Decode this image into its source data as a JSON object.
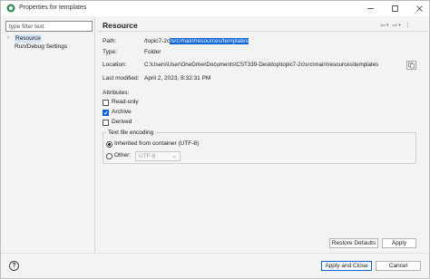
{
  "window": {
    "title": "Properties for templates"
  },
  "filter": {
    "placeholder": "type filter text"
  },
  "tree": {
    "items": [
      {
        "label": "Resource",
        "selected": true,
        "expandable": true
      },
      {
        "label": "Run/Debug Settings",
        "selected": false,
        "expandable": false
      }
    ]
  },
  "page": {
    "title": "Resource"
  },
  "info": {
    "path_label": "Path:",
    "path_prefix": "/topic7-2c",
    "path_selected": "/src/main/resources/templates",
    "type_label": "Type:",
    "type_value": "Folder",
    "location_label": "Location:",
    "location_value": "C:\\Users\\User\\OneDrive\\Documents\\CST339-Desktop\\topic7-2c\\src\\main\\resources\\templates",
    "modified_label": "Last modified:",
    "modified_value": "April 2, 2023, 8:32:31 PM"
  },
  "attributes": {
    "heading": "Attributes:",
    "items": [
      {
        "label": "Read-only",
        "checked": false
      },
      {
        "label": "Archive",
        "checked": true
      },
      {
        "label": "Derived",
        "checked": false
      }
    ]
  },
  "encoding": {
    "group_title": "Text file encoding",
    "inherited_label": "Inherited from container (UTF-8)",
    "other_label": "Other:",
    "other_value": "UTF-8",
    "selected": "inherited"
  },
  "buttons": {
    "restore_defaults": "Restore Defaults",
    "apply": "Apply",
    "apply_and_close": "Apply and Close",
    "cancel": "Cancel"
  },
  "colors": {
    "accent": "#0a64d6",
    "selection_bg": "#d6e6f7"
  }
}
